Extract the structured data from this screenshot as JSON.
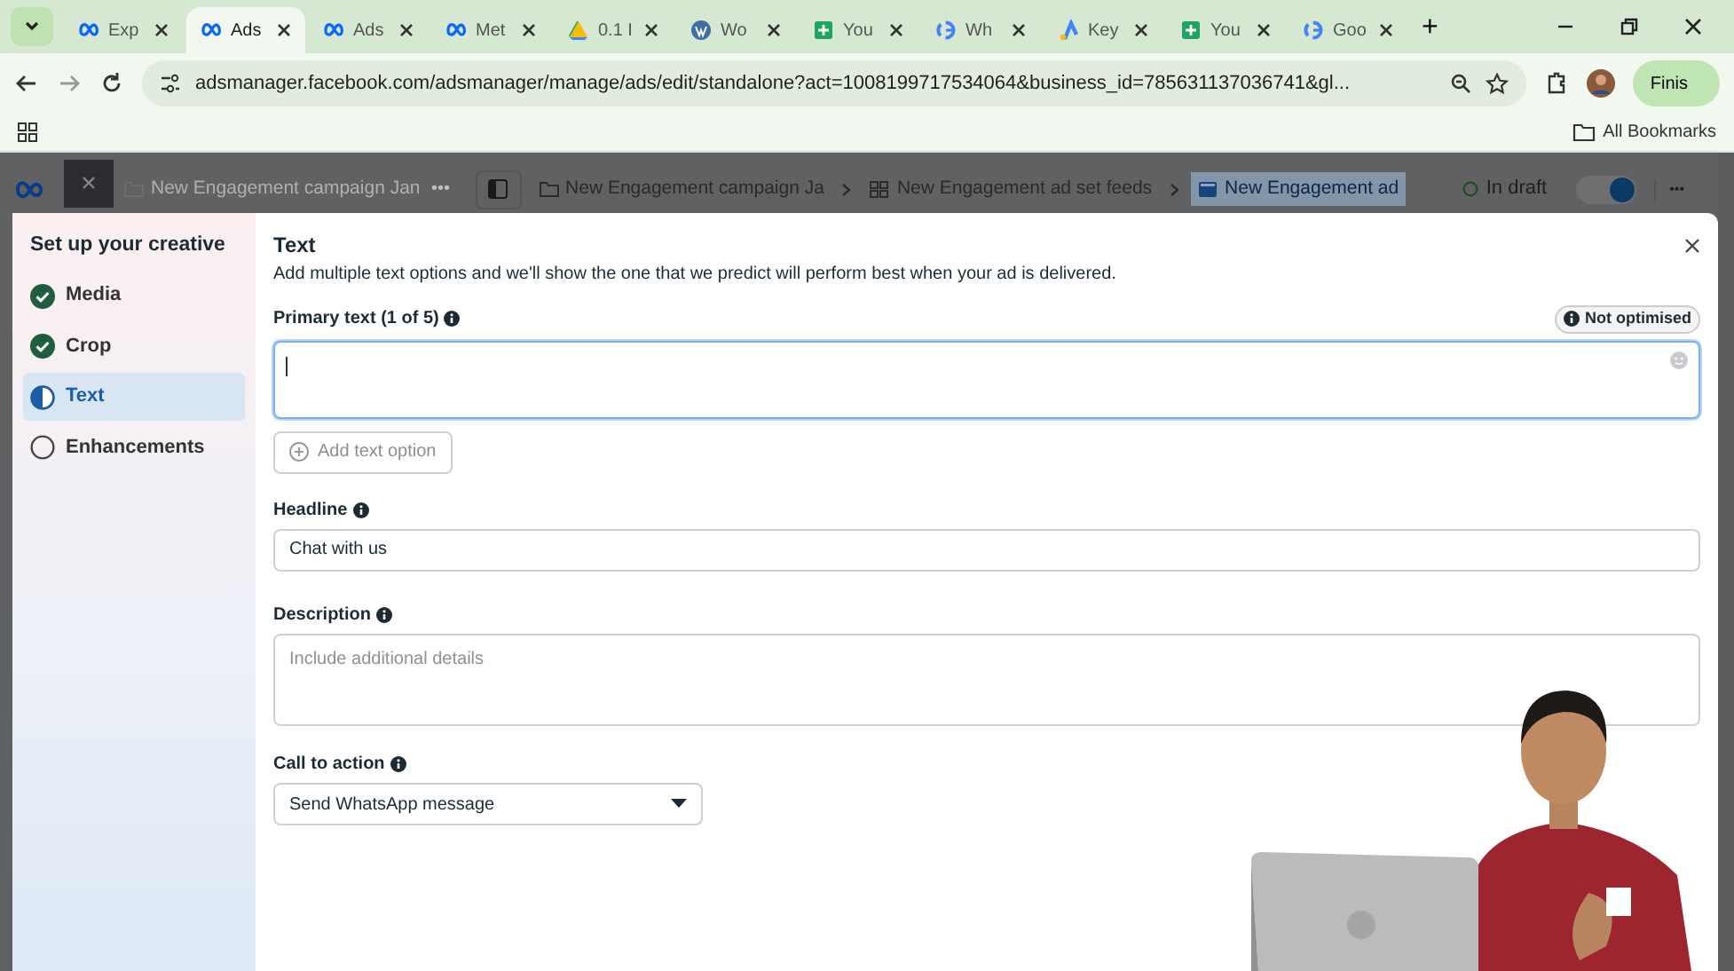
{
  "browser": {
    "tabs": [
      {
        "kind": "meta",
        "label": "Exp",
        "selected": false
      },
      {
        "kind": "meta",
        "label": "Ads",
        "selected": true
      },
      {
        "kind": "meta",
        "label": "Ads",
        "selected": false
      },
      {
        "kind": "meta",
        "label": "Met",
        "selected": false
      },
      {
        "kind": "drive",
        "label": "0.1 I",
        "selected": false
      },
      {
        "kind": "wordpress",
        "label": "Wo",
        "selected": false
      },
      {
        "kind": "sheets",
        "label": "You",
        "selected": false
      },
      {
        "kind": "google",
        "label": "Wh",
        "selected": false
      },
      {
        "kind": "ads",
        "label": "Key",
        "selected": false
      },
      {
        "kind": "sheets",
        "label": "You",
        "selected": false
      },
      {
        "kind": "google",
        "label": "Goo",
        "selected": false
      }
    ],
    "new_tab": "+",
    "url": "adsmanager.facebook.com/adsmanager/manage/ads/edit/standalone?act=1008199717534064&business_id=785631137036741&gl...",
    "profile_button": "Finis",
    "bookmarks": {
      "label": "All Bookmarks"
    }
  },
  "ads_manager": {
    "panel_title": "New Engagement campaign Jan",
    "more": "•••",
    "breadcrumbs": [
      {
        "kind": "campaign",
        "label": "New Engagement campaign Ja",
        "selected": false
      },
      {
        "kind": "ad_set",
        "label": "New Engagement ad set feeds",
        "selected": false
      },
      {
        "kind": "ad",
        "label": "New Engagement ad",
        "selected": true
      }
    ],
    "status": "In draft",
    "toggle": {
      "on": true
    },
    "menu": "•••"
  },
  "dialog": {
    "sidebar_title": "Set up your creative",
    "steps": [
      {
        "label": "Media",
        "kind": "done",
        "selected": false
      },
      {
        "label": "Crop",
        "kind": "done",
        "selected": false
      },
      {
        "label": "Text",
        "kind": "current",
        "selected": true
      },
      {
        "label": "Enhancements",
        "kind": "todo",
        "selected": false
      }
    ],
    "title": "Text",
    "subtitle": "Add multiple text options and we'll show the one that we predict will perform best when your ad is delivered.",
    "primary_text": {
      "label": "Primary text (1 of 5)",
      "badge": "Not optimised",
      "focused": true
    },
    "add_option": {
      "label": "Add text option",
      "disabled": true
    },
    "headline": {
      "label": "Headline",
      "value": "Chat with us"
    },
    "description": {
      "label": "Description",
      "placeholder": "Include additional details"
    },
    "call_to_action": {
      "label": "Call to action",
      "value": "Send WhatsApp message"
    }
  }
}
